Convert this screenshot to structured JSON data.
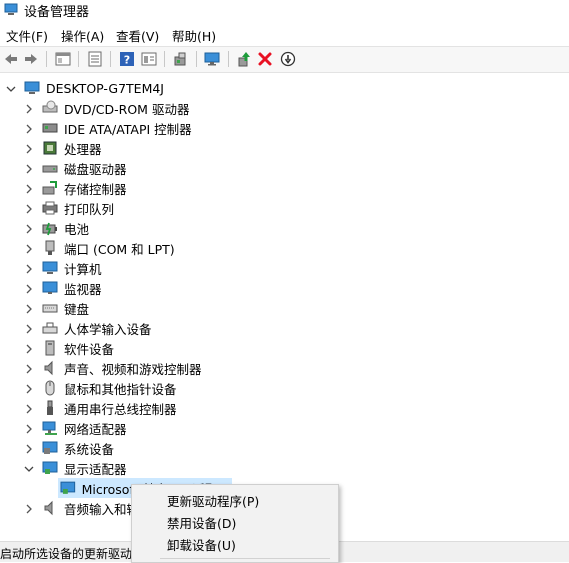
{
  "window": {
    "title": "设备管理器"
  },
  "menu": [
    "文件(F)",
    "操作(A)",
    "查看(V)",
    "帮助(H)"
  ],
  "toolbar": {
    "icons": [
      "back-arrow-icon",
      "forward-arrow-icon",
      "properties-panel-icon",
      "list-view-icon",
      "help-icon",
      "details-view-icon",
      "scan-hardware-icon",
      "monitor-icon",
      "update-driver-icon",
      "uninstall-icon",
      "disable-icon"
    ],
    "accent_red": "#e81123",
    "accent_green": "#1e9c3b"
  },
  "tree": {
    "root": "DESKTOP-G7TEM4J",
    "categories": [
      "DVD/CD-ROM 驱动器",
      "IDE ATA/ATAPI 控制器",
      "处理器",
      "磁盘驱动器",
      "存储控制器",
      "打印队列",
      "电池",
      "端口 (COM 和 LPT)",
      "计算机",
      "监视器",
      "键盘",
      "人体学输入设备",
      "软件设备",
      "声音、视频和游戏控制器",
      "鼠标和其他指针设备",
      "通用串行总线控制器",
      "网络适配器",
      "系统设备",
      "显示适配器"
    ],
    "expanded_child": "Microsoft 基本显示适配器",
    "after_category": "音频输入和输出"
  },
  "context_menu": {
    "items": [
      "更新驱动程序(P)",
      "禁用设备(D)",
      "卸载设备(U)"
    ]
  },
  "status": {
    "text": "启动所选设备的更新驱动程序向导。"
  }
}
